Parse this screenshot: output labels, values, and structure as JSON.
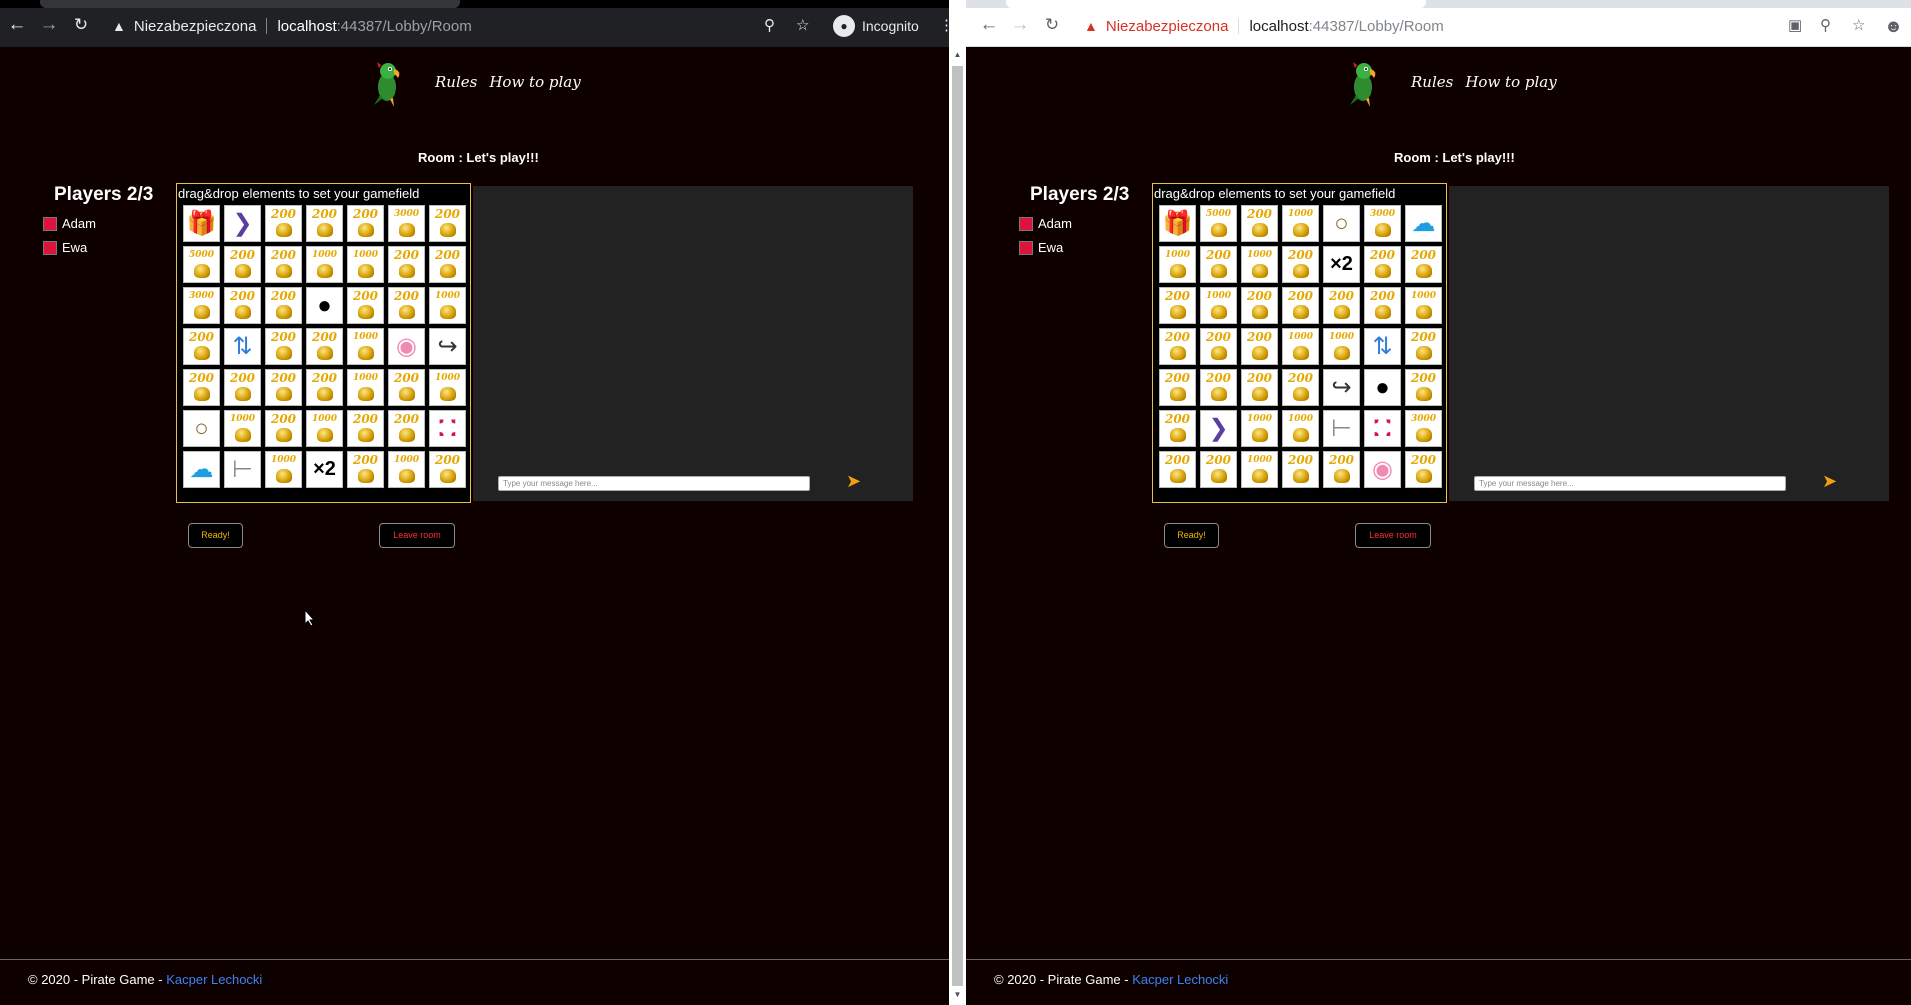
{
  "left": {
    "chrome": {
      "security": "Niezabezpieczona",
      "host": "localhost",
      "path": ":44387/Lobby/Room",
      "incognito": "Incognito"
    }
  },
  "right": {
    "chrome": {
      "security": "Niezabezpieczona",
      "host": "localhost",
      "path": ":44387/Lobby/Room"
    }
  },
  "nav": {
    "rules": "Rules",
    "how_to_play": "How to play"
  },
  "room_title": "Room : Let's play!!!",
  "players": {
    "title": "Players 2/3",
    "list": [
      "Adam",
      "Ewa"
    ],
    "color": "#dc143c"
  },
  "field_hint": "drag&drop elements to set your gamefield",
  "chat_placeholder": "Type your message here...",
  "buttons": {
    "ready": "Ready!",
    "leave": "Leave room"
  },
  "footer": {
    "text": "© 2020 - Pirate Game - ",
    "author": "Kacper Lechocki"
  },
  "grid_left": [
    [
      "gift",
      "next",
      "200",
      "200",
      "200",
      "3000",
      "200"
    ],
    [
      "5000",
      "200",
      "200",
      "1000",
      "1000",
      "200",
      "200"
    ],
    [
      "3000",
      "200",
      "200",
      "bomb",
      "200",
      "200",
      "1000"
    ],
    [
      "200",
      "swap",
      "200",
      "200",
      "1000",
      "pig",
      "hook"
    ],
    [
      "200",
      "200",
      "200",
      "200",
      "1000",
      "200",
      "1000"
    ],
    [
      "mirror",
      "1000",
      "200",
      "1000",
      "200",
      "200",
      "shield"
    ],
    [
      "blob",
      "gun",
      "1000",
      "x2",
      "200",
      "1000",
      "200"
    ]
  ],
  "grid_right": [
    [
      "gift",
      "5000",
      "200",
      "1000",
      "mirror",
      "3000",
      "blob"
    ],
    [
      "1000",
      "200",
      "1000",
      "200",
      "x2",
      "200",
      "200"
    ],
    [
      "200",
      "1000",
      "200",
      "200",
      "200",
      "200",
      "1000"
    ],
    [
      "200",
      "200",
      "200",
      "1000",
      "1000",
      "swap",
      "200"
    ],
    [
      "200",
      "200",
      "200",
      "200",
      "hook",
      "bomb",
      "200"
    ],
    [
      "200",
      "next",
      "1000",
      "1000",
      "gun",
      "shield",
      "3000"
    ],
    [
      "200",
      "200",
      "1000",
      "200",
      "200",
      "pig",
      "200"
    ]
  ]
}
